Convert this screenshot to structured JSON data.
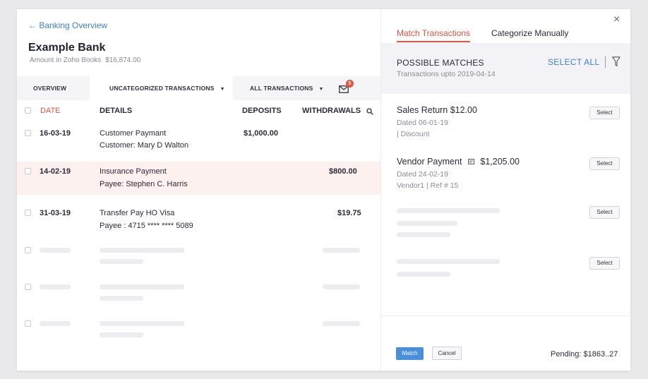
{
  "left": {
    "back_link": "← Banking Overview",
    "bank_name": "Example Bank",
    "amount_label": "Amount in Zoho Books",
    "amount_value": "$16,874.00",
    "tabs": {
      "overview": "OVERVIEW",
      "uncategorized": "UNCATEGORIZED TRANSACTIONS",
      "all": "ALL TRANSACTIONS"
    },
    "mail_badge": "5",
    "columns": {
      "date": "DATE",
      "details": "DETAILS",
      "deposits": "DEPOSITS",
      "withdrawals": "WITHDRAWALS"
    },
    "rows": [
      {
        "date": "16-03-19",
        "title": "Customer Paymant",
        "sub": "Customer: Mary D Walton",
        "deposit": "$1,000.00",
        "withdrawal": ""
      },
      {
        "date": "14-02-19",
        "title": "Insurance Payment",
        "sub": "Payee: Stephen C. Harris",
        "deposit": "",
        "withdrawal": "$800.00"
      },
      {
        "date": "31-03-19",
        "title": "Transfer Pay HO Visa",
        "sub": "Payee : 4715 **** **** 5089",
        "deposit": "",
        "withdrawal": "$19.75"
      }
    ]
  },
  "right": {
    "tab_match": "Match Transactions",
    "tab_categorize": "Categorize Manually",
    "close": "×",
    "possible_matches": "POSSIBLE MATCHES",
    "transactions_upto": "Transactions upto 2019-04-14",
    "select_all": "SELECT ALL",
    "matches": [
      {
        "title": "Sales Return $12.00",
        "dated": "Dated 06-01-19",
        "detail": "| Discount"
      },
      {
        "title_prefix": "Vendor Payment",
        "title_amount": "$1,205.00",
        "dated": "Dated 24-02-19",
        "detail": "Vendor1 | Ref # 15"
      }
    ],
    "select_label": "Select",
    "match_button": "Match",
    "cancel_button": "Cancel",
    "pending": "Pending: $1863..27"
  },
  "colors": {
    "accent_red": "#e8523e",
    "link_blue": "#3f7fd1",
    "button_blue": "#4a8fdc",
    "highlight_row": "#fcf1ee"
  }
}
